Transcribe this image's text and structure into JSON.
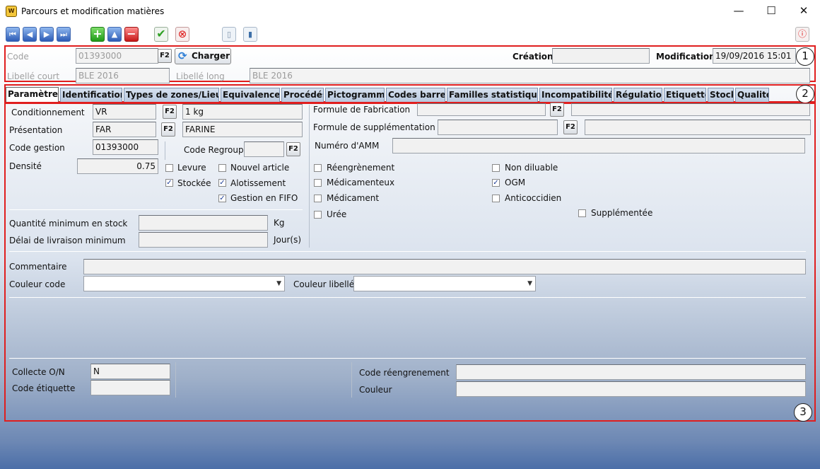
{
  "window": {
    "title": "Parcours et modification matières",
    "minimize": "—",
    "maximize": "☐",
    "close": "✕"
  },
  "toolbar": {
    "first": "⏮",
    "prev": "◀",
    "next": "▶",
    "last": "⏭",
    "add": "+",
    "up": "▲",
    "remove": "−",
    "validate": "✔",
    "cancel": "⊗",
    "doc1": "▯",
    "doc2": "▮",
    "info": "ⓘ"
  },
  "header": {
    "code_label": "Code",
    "code_value": "01393000",
    "f2": "F2",
    "charger_label": "Charger",
    "creation_label": "Création",
    "creation_value": "",
    "modification_label": "Modification",
    "modification_value": "19/09/2016 15:01",
    "libelle_court_label": "Libellé court",
    "libelle_court_value": "BLE 2016",
    "libelle_long_label": "Libellé long",
    "libelle_long_value": "BLE 2016"
  },
  "badges": {
    "one": "1",
    "two": "2",
    "three": "3"
  },
  "tabs": [
    "Paramètres",
    "Identification",
    "Types de zones/Lieux",
    "Equivalences",
    "Procédés",
    "Pictogramme",
    "Codes barres",
    "Familles statistiques",
    "Incompatibilités",
    "Régulation",
    "Etiquette",
    "Stock",
    "Qualité"
  ],
  "params": {
    "conditionnement_label": "Conditionnement",
    "conditionnement_code": "VR",
    "conditionnement_desc": "1 kg",
    "presentation_label": "Présentation",
    "presentation_code": "FAR",
    "presentation_desc": "FARINE",
    "code_gestion_label": "Code gestion",
    "code_gestion_value": "01393000",
    "code_regroup_label": "Code Regroup.",
    "code_regroup_value": "",
    "densite_label": "Densité",
    "densite_value": "0.75",
    "levure_label": "Levure",
    "levure_checked": false,
    "nouvel_article_label": "Nouvel article",
    "nouvel_article_checked": false,
    "stockee_label": "Stockée",
    "stockee_checked": true,
    "alotissement_label": "Alotissement",
    "alotissement_checked": true,
    "fifo_label": "Gestion en FIFO",
    "fifo_checked": true,
    "qte_min_label": "Quantité minimum en stock",
    "qte_min_value": "",
    "qte_unit": "Kg",
    "delai_label": "Délai de livraison minimum",
    "delai_value": "",
    "delai_unit": "Jour(s)",
    "formule_fab_label": "Formule de Fabrication",
    "formule_fab_value": "",
    "formule_fab_desc": "",
    "formule_supp_label": "Formule de supplémentation",
    "formule_supp_value": "",
    "formule_supp_desc": "",
    "amm_label": "Numéro d'AMM",
    "amm_value": "",
    "reengrenement_label": "Réengrènement",
    "reengrenement_checked": false,
    "non_diluable_label": "Non diluable",
    "non_diluable_checked": false,
    "medicamenteux_label": "Médicamenteux",
    "medicamenteux_checked": false,
    "ogm_label": "OGM",
    "ogm_checked": true,
    "medicament_label": "Médicament",
    "medicament_checked": false,
    "anticoccidien_label": "Anticoccidien",
    "anticoccidien_checked": false,
    "uree_label": "Urée",
    "uree_checked": false,
    "supplementee_label": "Supplémentée",
    "supplementee_checked": false,
    "commentaire_label": "Commentaire",
    "commentaire_value": "",
    "couleur_code_label": "Couleur code",
    "couleur_code_value": "",
    "couleur_libelle_label": "Couleur libellé",
    "couleur_libelle_value": "",
    "collecte_label": "Collecte O/N",
    "collecte_value": "N",
    "code_etiquette_label": "Code étiquette",
    "code_etiquette_value": "",
    "code_reengrenement_label": "Code réengrenement",
    "code_reengrenement_value": "",
    "couleur_label": "Couleur",
    "couleur_value": ""
  }
}
